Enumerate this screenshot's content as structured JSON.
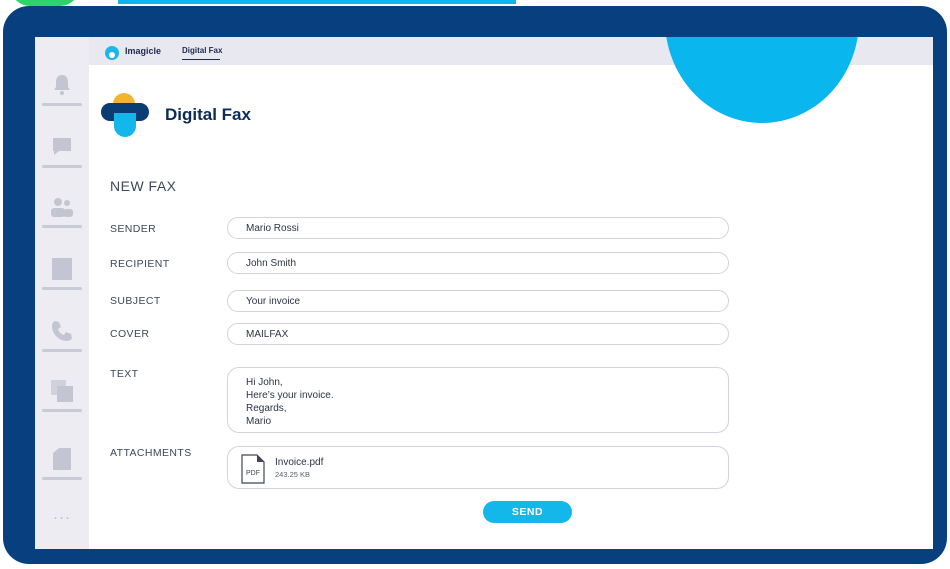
{
  "topbar": {
    "brand": "Imagicle",
    "active_tab": "Digital Fax"
  },
  "app": {
    "title": "Digital Fax"
  },
  "form": {
    "section_title": "NEW FAX",
    "fields": [
      {
        "label": "SENDER",
        "value": "Mario Rossi"
      },
      {
        "label": "RECIPIENT",
        "value": "John Smith"
      },
      {
        "label": "SUBJECT",
        "value": "Your invoice"
      },
      {
        "label": "COVER",
        "value": "MAILFAX"
      }
    ],
    "text_label": "TEXT",
    "text_lines": [
      "Hi John,",
      "Here’s your invoice.",
      "Regards,",
      "Mario"
    ],
    "attachments_label": "ATTACHMENTS",
    "attachment": {
      "icon_text": "PDF",
      "name": "Invoice.pdf",
      "size": "243.25 KB"
    },
    "send_label": "SEND"
  },
  "sidebar": {
    "items": [
      "bell-icon",
      "chat-icon",
      "contacts-icon",
      "book-icon",
      "phone-icon",
      "pages-icon",
      "document-icon"
    ],
    "more": "···"
  },
  "colors": {
    "frame": "#08407f",
    "accent": "#13b7ea",
    "logo_yellow": "#f7b234",
    "logo_navy": "#0b3d75"
  }
}
